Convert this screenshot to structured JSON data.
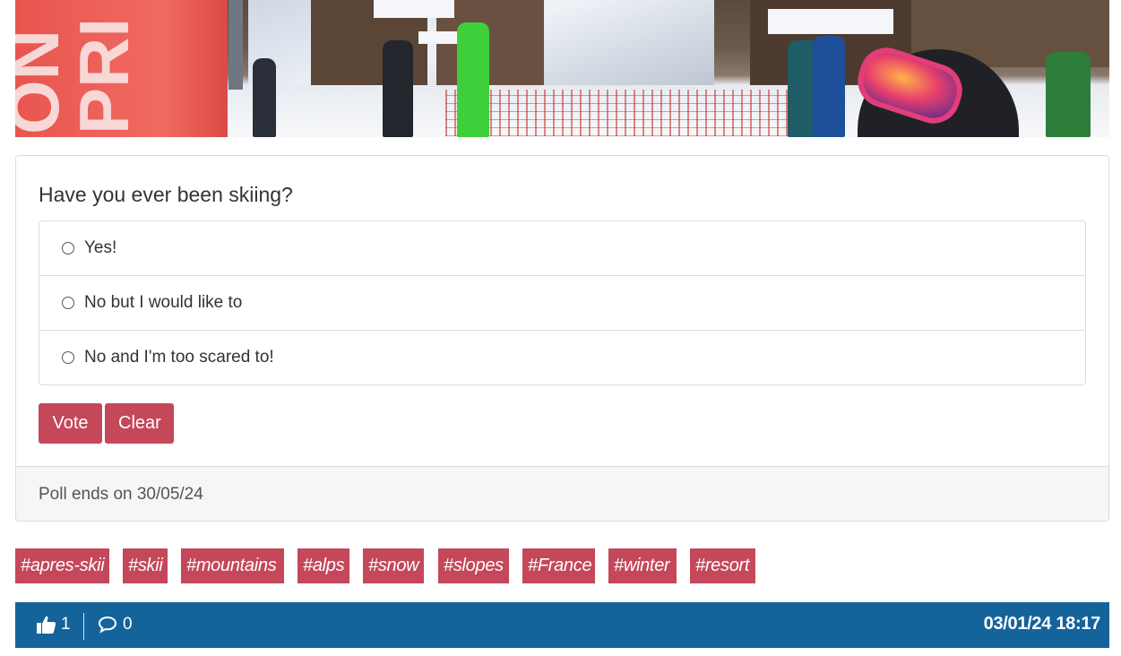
{
  "banner": {
    "flag_text": "ON PRI"
  },
  "poll": {
    "question": "Have you ever been skiing?",
    "options": [
      {
        "label": "Yes!"
      },
      {
        "label": "No but I would like to"
      },
      {
        "label": "No and I'm too scared to!"
      }
    ],
    "vote_label": "Vote",
    "clear_label": "Clear",
    "ends_text": "Poll ends on 30/05/24",
    "accent_color": "#c4475a"
  },
  "tags": [
    "#apres-skii",
    "#skii",
    "#mountains",
    "#alps",
    "#snow",
    "#slopes",
    "#France",
    "#winter",
    "#resort"
  ],
  "footer": {
    "likes": "1",
    "comments": "0",
    "timestamp": "03/01/24 18:17",
    "like_icon": "thumbs-up-icon",
    "comment_icon": "comment-bubble-icon",
    "bar_color": "#15639b"
  }
}
